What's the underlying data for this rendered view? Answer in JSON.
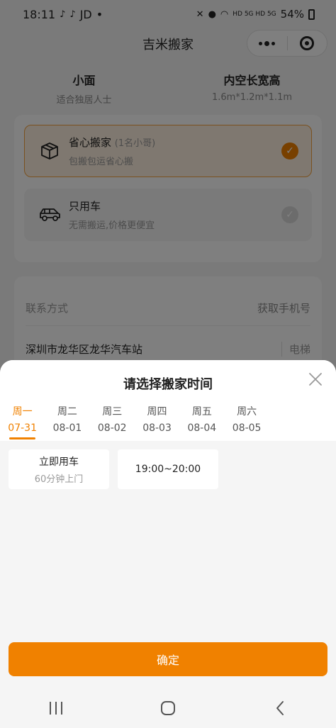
{
  "status_bar": {
    "time": "18:11",
    "apps": "JD",
    "network": "HD 5G HD 5G",
    "battery": "54%"
  },
  "nav": {
    "title": "吉米搬家"
  },
  "vehicle": {
    "type_title": "小面",
    "type_sub": "适合独居人士",
    "size_title": "内空长宽高",
    "size_sub": "1.6m*1.2m*1.1m"
  },
  "services": [
    {
      "title": "省心搬家",
      "sub": "(1名小哥)",
      "desc": "包搬包运省心搬",
      "selected": true
    },
    {
      "title": "只用车",
      "sub": "",
      "desc": "无需搬运,价格更便宜",
      "selected": false
    }
  ],
  "contact": {
    "label": "联系方式",
    "action": "获取手机号",
    "address": "深圳市龙华区龙华汽车站",
    "elevator": "电梯"
  },
  "sheet": {
    "title": "请选择搬家时间",
    "days": [
      {
        "week": "周一",
        "date": "07-31",
        "active": true
      },
      {
        "week": "周二",
        "date": "08-01",
        "active": false
      },
      {
        "week": "周三",
        "date": "08-02",
        "active": false
      },
      {
        "week": "周四",
        "date": "08-03",
        "active": false
      },
      {
        "week": "周五",
        "date": "08-04",
        "active": false
      },
      {
        "week": "周六",
        "date": "08-05",
        "active": false
      }
    ],
    "slots": [
      {
        "label": "立即用车",
        "sub": "60分钟上门"
      },
      {
        "label": "19:00~20:00",
        "sub": ""
      }
    ],
    "confirm": "确定"
  },
  "colors": {
    "accent": "#f08100"
  }
}
